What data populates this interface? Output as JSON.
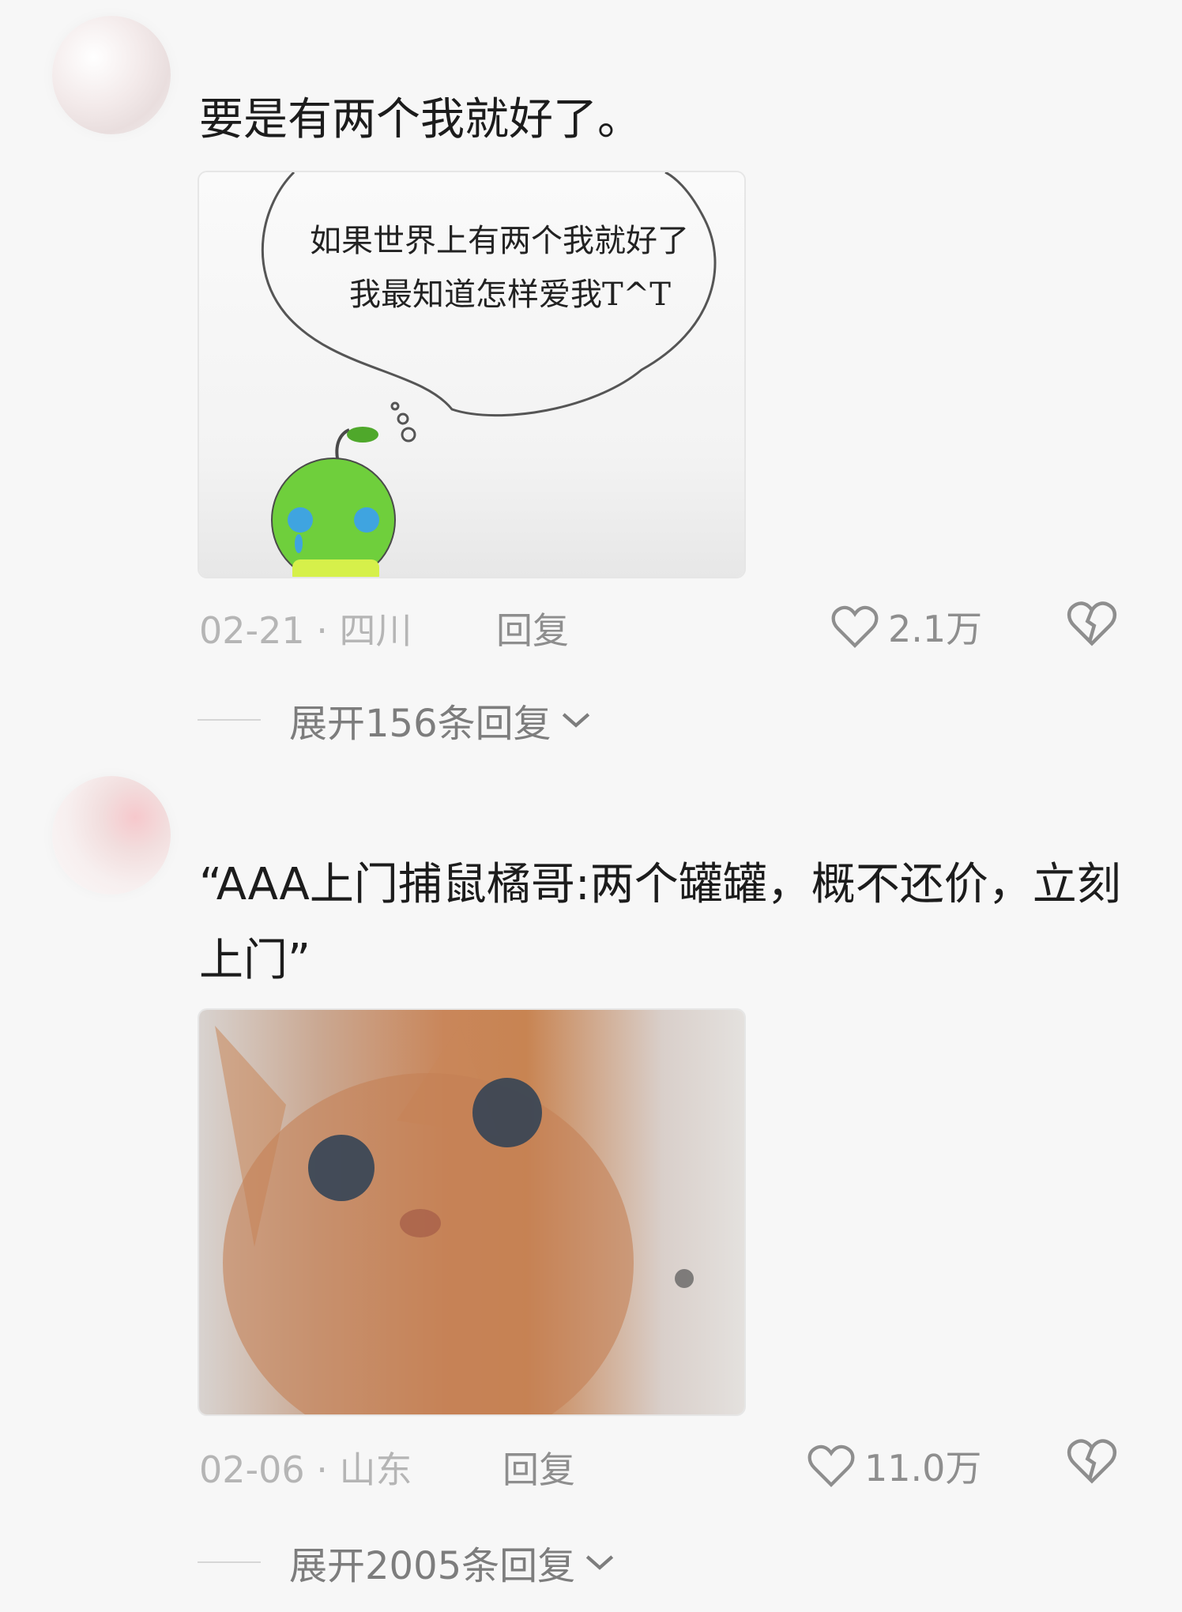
{
  "comments": [
    {
      "text": "要是有两个我就好了。",
      "image_text_line1": "如果世界上有两个我就好了",
      "image_text_line2": "我最知道怎样爱我T^T",
      "date": "02-21",
      "location": "四川",
      "reply_label": "回复",
      "likes": "2.1万",
      "expand_label": "展开156条回复"
    },
    {
      "text": "“AAA上门捕鼠橘哥:两个罐罐，概不还价，立刻上门”",
      "date": "02-06",
      "location": "山东",
      "reply_label": "回复",
      "likes": "11.0万",
      "expand_label": "展开2005条回复"
    }
  ],
  "icons": {
    "like": "heart-outline-icon",
    "dislike": "broken-heart-icon",
    "expand": "chevron-down-icon"
  },
  "colors": {
    "background": "#f7f7f7",
    "primary_text": "#1c1c1c",
    "meta_text": "#b5b5b5",
    "action_text": "#8e8e8e"
  }
}
